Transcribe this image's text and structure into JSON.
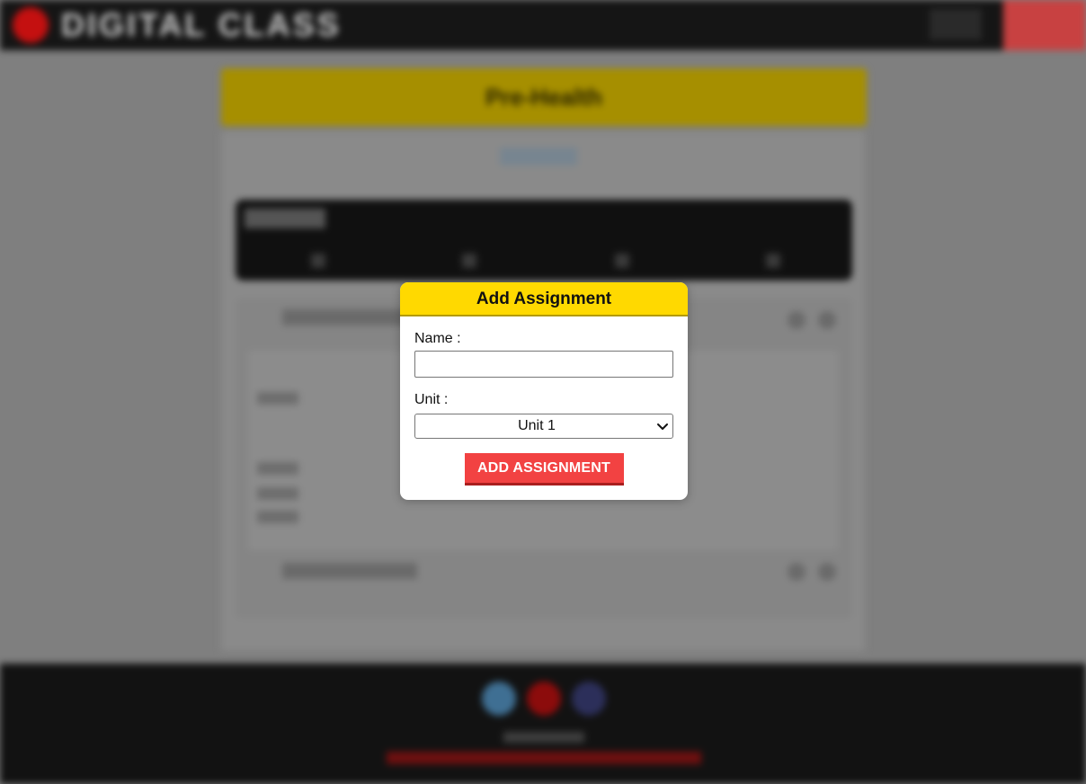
{
  "background": {
    "logo_text": "DIGITAL CLASSROOM",
    "header_title": "Pre-Health"
  },
  "modal": {
    "title": "Add Assignment",
    "name_label": "Name :",
    "name_value": "",
    "unit_label": "Unit :",
    "unit_selected": "Unit 1",
    "submit_label": "ADD ASSIGNMENT"
  },
  "colors": {
    "modal_header": "#ffd900",
    "submit_button": "#f24242",
    "overlay": "#7f7f7f",
    "topbar": "#151515",
    "footer": "#121212"
  },
  "icons": {
    "select_arrow": "chevron-down-icon",
    "social": [
      "twitter-icon",
      "youtube-icon",
      "facebook-icon"
    ]
  }
}
